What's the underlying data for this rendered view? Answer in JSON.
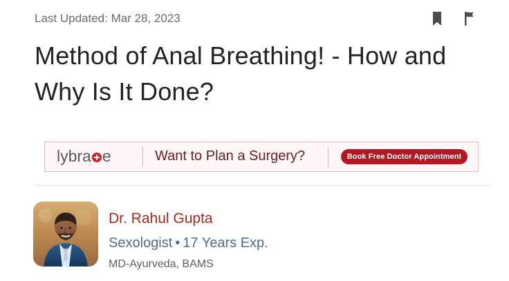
{
  "article": {
    "last_updated": "Last Updated: Mar 28, 2023",
    "title_line_1": "Method of Anal Breathing! - How and",
    "title_line_2": "Why Is It Done?"
  },
  "actions": {
    "bookmark_icon": "bookmark-icon",
    "flag_icon": "flag-icon"
  },
  "banner": {
    "brand_left": "lybra",
    "brand_right": "e",
    "headline": "Want to Plan a Surgery?",
    "cta": "Book Free Doctor Appointment",
    "brand_icon": "plus-icon"
  },
  "author": {
    "name": "Dr. Rahul Gupta",
    "specialty": "Sexologist",
    "separator": "•",
    "experience": "17 Years Exp.",
    "degrees": "MD-Ayurveda, BAMS"
  },
  "colors": {
    "title": "#222222",
    "meta_gray": "#6b6b6b",
    "brand_red": "#b1251d",
    "banner_border": "#e2b9b9",
    "banner_bg": "#fff7f7",
    "banner_text": "#6c1d1d",
    "cta_bg": "#b11822",
    "author_meta": "#4d6f86"
  }
}
